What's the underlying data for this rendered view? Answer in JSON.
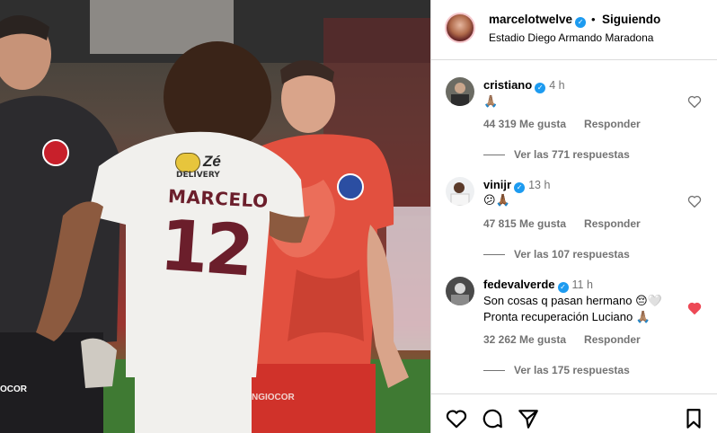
{
  "post": {
    "username": "marcelotwelve",
    "separator": "•",
    "follow_label": "Siguiendo",
    "location": "Estadio Diego Armando Maradona",
    "photo": {
      "player_name": "MARCELO",
      "player_number": "12",
      "sponsor_brand": "Zé",
      "sponsor_text": "DELIVERY",
      "sleeve_left": "OCOR",
      "sleeve_right": "NGIOCOR"
    }
  },
  "comments": [
    {
      "username": "cristiano",
      "time": "4 h",
      "text": "🙏🏽",
      "likes": "44 319 Me gusta",
      "reply_label": "Responder",
      "replies_label": "Ver las 771 respuestas",
      "liked": false
    },
    {
      "username": "vinijr",
      "time": "13 h",
      "text": "😕🙏🏾",
      "likes": "47 815 Me gusta",
      "reply_label": "Responder",
      "replies_label": "Ver las 107 respuestas",
      "liked": false
    },
    {
      "username": "fedevalverde",
      "time": "11 h",
      "text_line1": "Son cosas q pasan hermano 😔🤍",
      "text_line2": "Pronta recuperación Luciano 🙏🏽",
      "likes": "32 262 Me gusta",
      "reply_label": "Responder",
      "replies_label": "Ver las 175 respuestas",
      "liked": true
    }
  ],
  "icons": [
    "heart-icon",
    "comment-icon",
    "share-icon",
    "bookmark-icon",
    "verified-badge-icon"
  ],
  "colors": {
    "verified": "#1d9bf0",
    "liked_heart": "#ed4956",
    "muted_text": "#737373"
  }
}
